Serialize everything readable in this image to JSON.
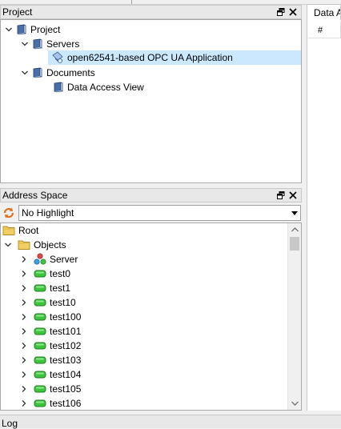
{
  "project_panel": {
    "title": "Project",
    "tree": [
      {
        "label": "Project",
        "icon": "book-icon"
      },
      {
        "label": "Servers",
        "icon": "book-icon"
      },
      {
        "label": "open62541-based OPC UA Application",
        "icon": "server-connection-icon"
      },
      {
        "label": "Documents",
        "icon": "book-icon"
      },
      {
        "label": "Data Access View",
        "icon": "book-icon"
      }
    ]
  },
  "address_panel": {
    "title": "Address Space",
    "highlight": "No Highlight",
    "root": "Root",
    "objects": "Objects",
    "items": [
      "Server",
      "test0",
      "test1",
      "test10",
      "test100",
      "test101",
      "test102",
      "test103",
      "test104",
      "test105",
      "test106"
    ]
  },
  "right_panel": {
    "tab_label": "Data A",
    "column_header": "#"
  },
  "log_panel": {
    "title": "Log"
  },
  "colors": {
    "selection": "#cce8ff",
    "folder": "#f2cf63",
    "variable": "#3ec33e",
    "book": "#4a6ea8"
  }
}
